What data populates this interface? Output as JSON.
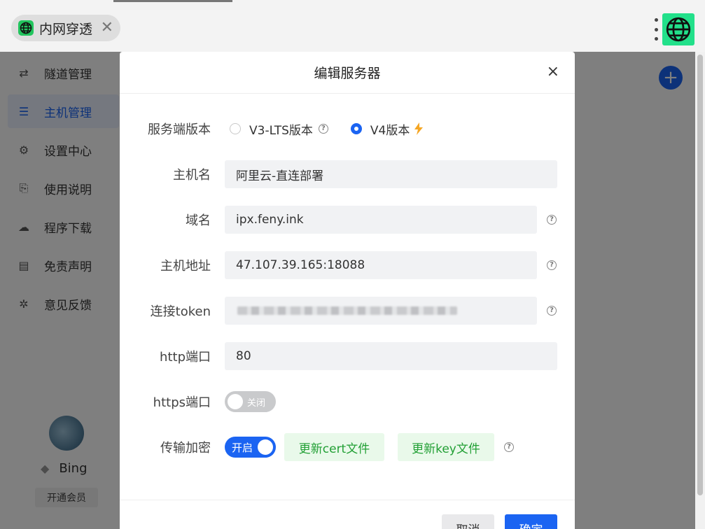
{
  "tab": {
    "title": "内网穿透",
    "close": "✕"
  },
  "sidebar": {
    "items": [
      {
        "label": "隧道管理",
        "icon": "swap-arrows-icon",
        "glyph": "⇄"
      },
      {
        "label": "主机管理",
        "icon": "server-list-icon",
        "glyph": "☰"
      },
      {
        "label": "设置中心",
        "icon": "gear-icon",
        "glyph": "⚙"
      },
      {
        "label": "使用说明",
        "icon": "document-search-icon",
        "glyph": "⎘"
      },
      {
        "label": "程序下载",
        "icon": "cloud-download-icon",
        "glyph": "☁"
      },
      {
        "label": "免责声明",
        "icon": "document-icon",
        "glyph": "▤"
      },
      {
        "label": "意见反馈",
        "icon": "bug-icon",
        "glyph": "✲"
      }
    ],
    "active_index": 1
  },
  "user": {
    "name": "Bing",
    "vip_button": "开通会员"
  },
  "colors": {
    "accent": "#1b64f2",
    "brand_green": "#22e08a",
    "success_text": "#22a035"
  },
  "modal": {
    "title": "编辑服务器",
    "close": "×",
    "server_version": {
      "label": "服务端版本",
      "options": [
        "V3-LTS版本",
        "V4版本"
      ],
      "selected": "V4版本"
    },
    "hostname": {
      "label": "主机名",
      "value": "阿里云-直连部署"
    },
    "domain": {
      "label": "域名",
      "value": "ipx.feny.ink"
    },
    "host_address": {
      "label": "主机地址",
      "value": "47.107.39.165:18088"
    },
    "token": {
      "label": "连接token",
      "value": ""
    },
    "http_port": {
      "label": "http端口",
      "value": "80"
    },
    "https_port": {
      "label": "https端口",
      "toggle_label": "关闭",
      "enabled": false
    },
    "encryption": {
      "label": "传输加密",
      "toggle_label": "开启",
      "enabled": true,
      "cert_button": "更新cert文件",
      "key_button": "更新key文件"
    },
    "help_glyph": "?",
    "cancel": "取消",
    "confirm": "确定"
  }
}
